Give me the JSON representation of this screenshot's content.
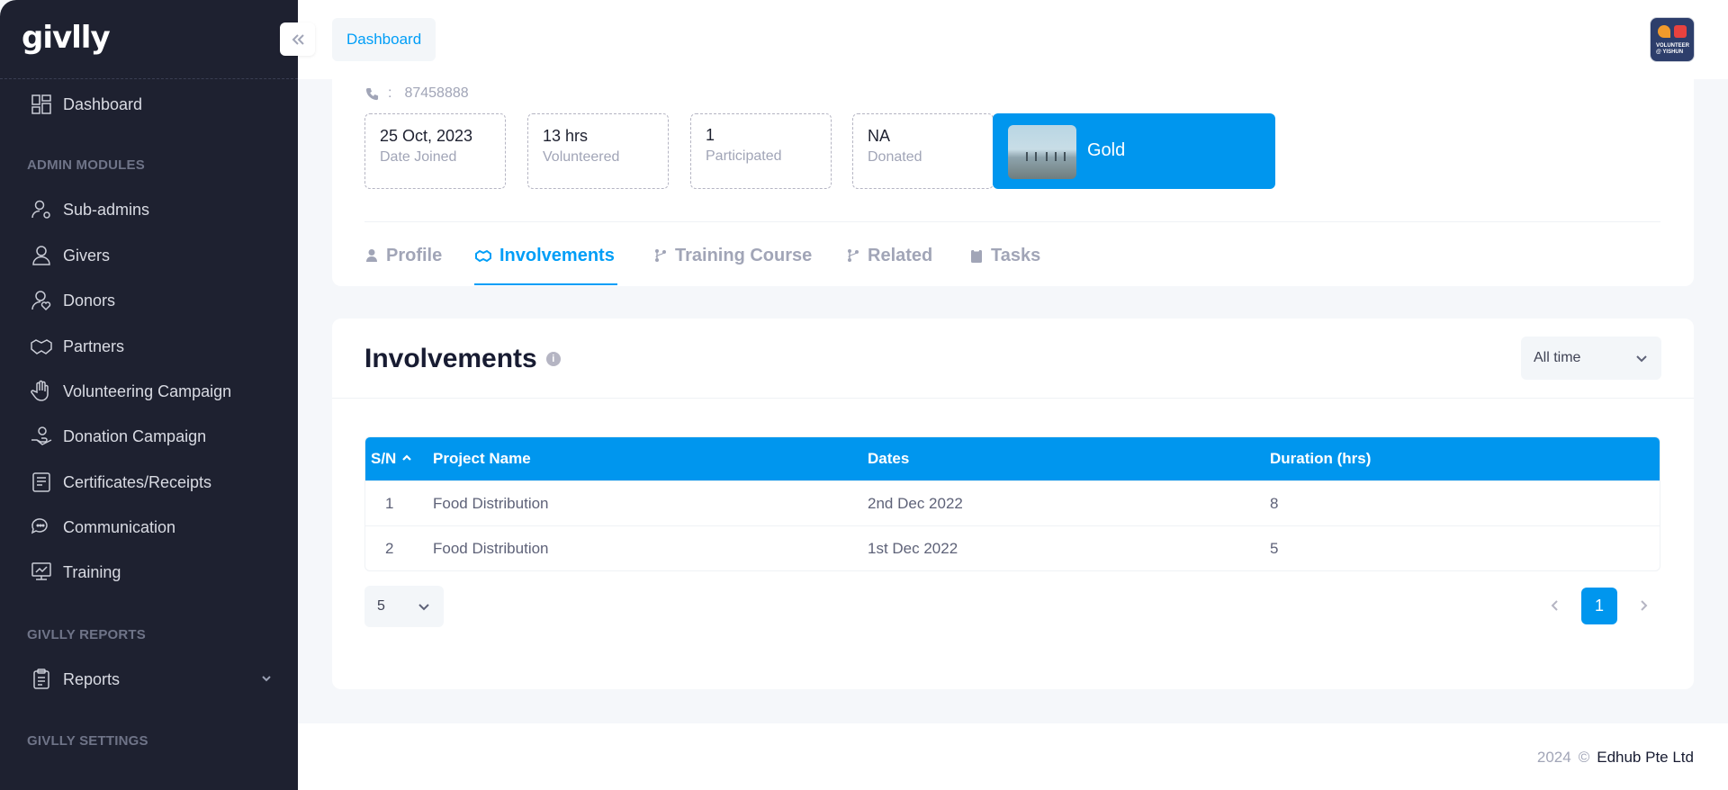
{
  "app": {
    "logo": "givlly"
  },
  "sidebar": {
    "dashboard": "Dashboard",
    "section_admin": "ADMIN MODULES",
    "items": [
      {
        "label": "Sub-admins",
        "icon": "users-gear-icon"
      },
      {
        "label": "Givers",
        "icon": "user-icon"
      },
      {
        "label": "Donors",
        "icon": "donor-icon"
      },
      {
        "label": "Partners",
        "icon": "handshake-icon"
      },
      {
        "label": "Volunteering Campaign",
        "icon": "hand-icon"
      },
      {
        "label": "Donation Campaign",
        "icon": "donation-icon"
      },
      {
        "label": "Certificates/Receipts",
        "icon": "certificate-icon"
      },
      {
        "label": "Communication",
        "icon": "chat-icon"
      },
      {
        "label": "Training",
        "icon": "training-icon"
      }
    ],
    "section_reports": "GIVLLY REPORTS",
    "reports": "Reports",
    "section_settings": "GIVLLY SETTINGS"
  },
  "header": {
    "breadcrumb": "Dashboard"
  },
  "profile": {
    "phone_sep": ":",
    "phone": "87458888",
    "stats": [
      {
        "value": "25 Oct, 2023",
        "label": "Date Joined"
      },
      {
        "value": "13 hrs",
        "label": "Volunteered"
      },
      {
        "value": "1",
        "label": "Participated"
      },
      {
        "value": "NA",
        "label": "Donated"
      }
    ],
    "tier": "Gold"
  },
  "tabs": [
    {
      "label": "Profile",
      "icon": "user-icon"
    },
    {
      "label": "Involvements",
      "icon": "handshake-icon"
    },
    {
      "label": "Training Course",
      "icon": "branch-icon"
    },
    {
      "label": "Related",
      "icon": "branch-icon"
    },
    {
      "label": "Tasks",
      "icon": "clipboard-icon"
    }
  ],
  "involvements": {
    "title": "Involvements",
    "info": "i",
    "range": "All time",
    "columns": {
      "sn": "S/N",
      "name": "Project Name",
      "dates": "Dates",
      "duration": "Duration (hrs)"
    },
    "rows": [
      {
        "sn": "1",
        "name": "Food Distribution",
        "dates": "2nd Dec 2022",
        "duration": "8"
      },
      {
        "sn": "2",
        "name": "Food Distribution",
        "dates": "1st Dec 2022",
        "duration": "5"
      }
    ],
    "page_size": "5",
    "current_page": "1"
  },
  "footer": {
    "year": "2024",
    "copyright": "©",
    "owner": "Edhub Pte Ltd"
  },
  "colors": {
    "primary": "#009ef7",
    "sidebar_bg": "#1e2130",
    "badge_bg": "#0096ee"
  }
}
